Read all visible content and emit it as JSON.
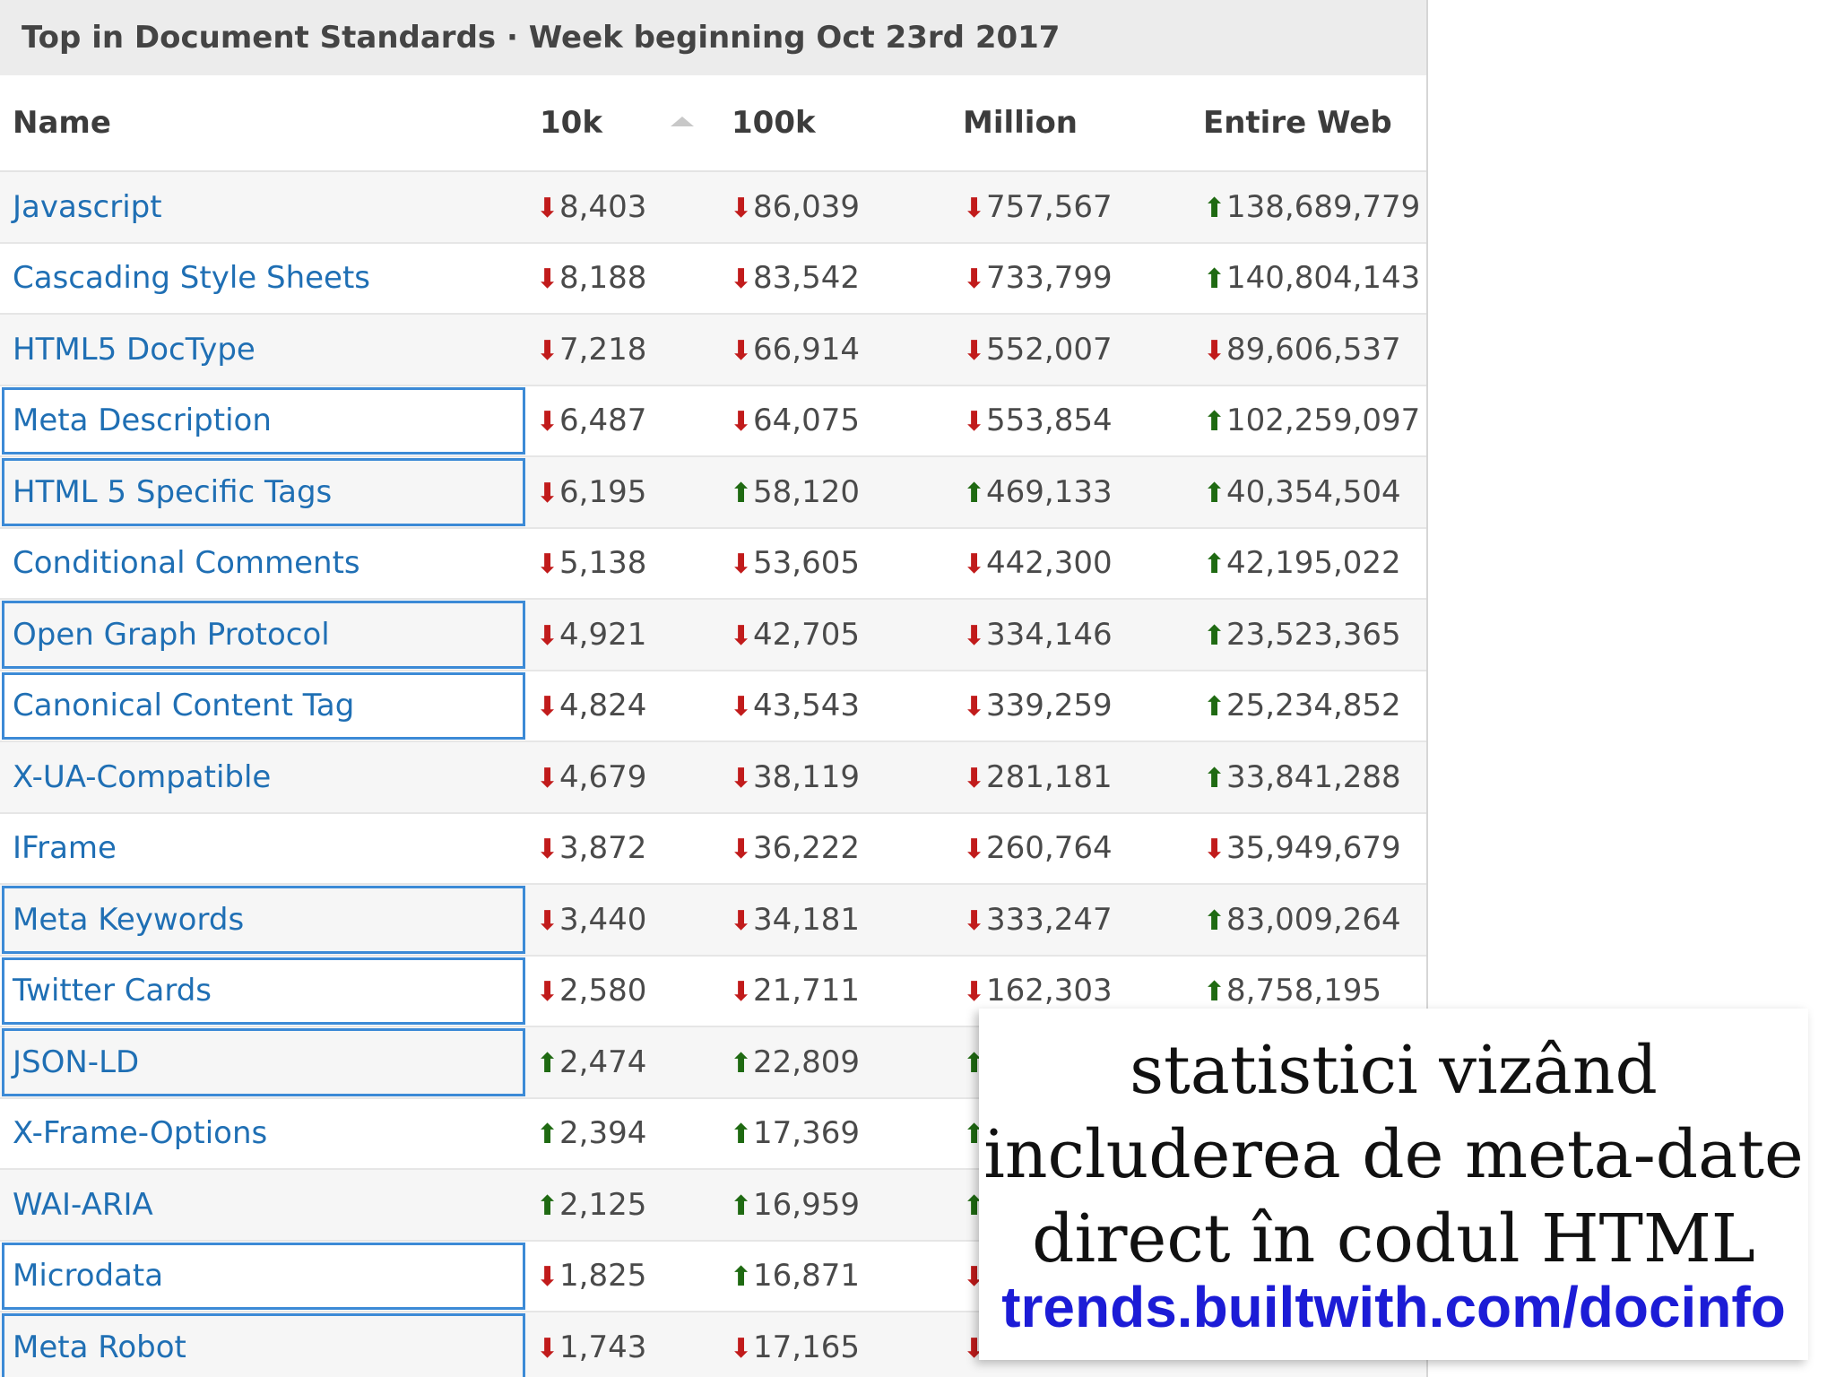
{
  "title": "Top in Document Standards · Week beginning Oct 23rd 2017",
  "columns": [
    "Name",
    "10k",
    "100k",
    "Million",
    "Entire Web"
  ],
  "sort_indicator": "sort-ascending-icon",
  "colors": {
    "link": "#1f6fb4",
    "down": "#c11b1b",
    "up": "#1f6a12",
    "selection_box": "#3c8ad6"
  },
  "rows": [
    {
      "name": "Javascript",
      "boxed": false,
      "k10": {
        "dir": "down",
        "value": "8,403"
      },
      "k100": {
        "dir": "down",
        "value": "86,039"
      },
      "million": {
        "dir": "down",
        "value": "757,567"
      },
      "web": {
        "dir": "up",
        "value": "138,689,779"
      }
    },
    {
      "name": "Cascading Style Sheets",
      "boxed": false,
      "k10": {
        "dir": "down",
        "value": "8,188"
      },
      "k100": {
        "dir": "down",
        "value": "83,542"
      },
      "million": {
        "dir": "down",
        "value": "733,799"
      },
      "web": {
        "dir": "up",
        "value": "140,804,143"
      }
    },
    {
      "name": "HTML5 DocType",
      "boxed": false,
      "k10": {
        "dir": "down",
        "value": "7,218"
      },
      "k100": {
        "dir": "down",
        "value": "66,914"
      },
      "million": {
        "dir": "down",
        "value": "552,007"
      },
      "web": {
        "dir": "down",
        "value": "89,606,537"
      }
    },
    {
      "name": "Meta Description",
      "boxed": true,
      "k10": {
        "dir": "down",
        "value": "6,487"
      },
      "k100": {
        "dir": "down",
        "value": "64,075"
      },
      "million": {
        "dir": "down",
        "value": "553,854"
      },
      "web": {
        "dir": "up",
        "value": "102,259,097"
      }
    },
    {
      "name": "HTML 5 Specific Tags",
      "boxed": true,
      "k10": {
        "dir": "down",
        "value": "6,195"
      },
      "k100": {
        "dir": "up",
        "value": "58,120"
      },
      "million": {
        "dir": "up",
        "value": "469,133"
      },
      "web": {
        "dir": "up",
        "value": "40,354,504"
      }
    },
    {
      "name": "Conditional Comments",
      "boxed": false,
      "k10": {
        "dir": "down",
        "value": "5,138"
      },
      "k100": {
        "dir": "down",
        "value": "53,605"
      },
      "million": {
        "dir": "down",
        "value": "442,300"
      },
      "web": {
        "dir": "up",
        "value": "42,195,022"
      }
    },
    {
      "name": "Open Graph Protocol",
      "boxed": true,
      "k10": {
        "dir": "down",
        "value": "4,921"
      },
      "k100": {
        "dir": "down",
        "value": "42,705"
      },
      "million": {
        "dir": "down",
        "value": "334,146"
      },
      "web": {
        "dir": "up",
        "value": "23,523,365"
      }
    },
    {
      "name": "Canonical Content Tag",
      "boxed": true,
      "k10": {
        "dir": "down",
        "value": "4,824"
      },
      "k100": {
        "dir": "down",
        "value": "43,543"
      },
      "million": {
        "dir": "down",
        "value": "339,259"
      },
      "web": {
        "dir": "up",
        "value": "25,234,852"
      }
    },
    {
      "name": "X-UA-Compatible",
      "boxed": false,
      "k10": {
        "dir": "down",
        "value": "4,679"
      },
      "k100": {
        "dir": "down",
        "value": "38,119"
      },
      "million": {
        "dir": "down",
        "value": "281,181"
      },
      "web": {
        "dir": "up",
        "value": "33,841,288"
      }
    },
    {
      "name": "IFrame",
      "boxed": false,
      "k10": {
        "dir": "down",
        "value": "3,872"
      },
      "k100": {
        "dir": "down",
        "value": "36,222"
      },
      "million": {
        "dir": "down",
        "value": "260,764"
      },
      "web": {
        "dir": "down",
        "value": "35,949,679"
      }
    },
    {
      "name": "Meta Keywords",
      "boxed": true,
      "k10": {
        "dir": "down",
        "value": "3,440"
      },
      "k100": {
        "dir": "down",
        "value": "34,181"
      },
      "million": {
        "dir": "down",
        "value": "333,247"
      },
      "web": {
        "dir": "up",
        "value": "83,009,264"
      }
    },
    {
      "name": "Twitter Cards",
      "boxed": true,
      "k10": {
        "dir": "down",
        "value": "2,580"
      },
      "k100": {
        "dir": "down",
        "value": "21,711"
      },
      "million": {
        "dir": "down",
        "value": "162,303"
      },
      "web": {
        "dir": "up",
        "value": "8,758,195"
      }
    },
    {
      "name": "JSON-LD",
      "boxed": true,
      "k10": {
        "dir": "up",
        "value": "2,474"
      },
      "k100": {
        "dir": "up",
        "value": "22,809"
      },
      "million": {
        "dir": "up",
        "value": ""
      },
      "web": {
        "dir": "",
        "value": ""
      }
    },
    {
      "name": "X-Frame-Options",
      "boxed": false,
      "k10": {
        "dir": "up",
        "value": "2,394"
      },
      "k100": {
        "dir": "up",
        "value": "17,369"
      },
      "million": {
        "dir": "up",
        "value": ""
      },
      "web": {
        "dir": "",
        "value": ""
      }
    },
    {
      "name": "WAI-ARIA",
      "boxed": false,
      "k10": {
        "dir": "up",
        "value": "2,125"
      },
      "k100": {
        "dir": "up",
        "value": "16,959"
      },
      "million": {
        "dir": "up",
        "value": ""
      },
      "web": {
        "dir": "",
        "value": ""
      }
    },
    {
      "name": "Microdata",
      "boxed": true,
      "k10": {
        "dir": "down",
        "value": "1,825"
      },
      "k100": {
        "dir": "up",
        "value": "16,871"
      },
      "million": {
        "dir": "down",
        "value": ""
      },
      "web": {
        "dir": "",
        "value": ""
      }
    },
    {
      "name": "Meta Robot",
      "boxed": true,
      "k10": {
        "dir": "down",
        "value": "1,743"
      },
      "k100": {
        "dir": "down",
        "value": "17,165"
      },
      "million": {
        "dir": "down",
        "value": ""
      },
      "web": {
        "dir": "",
        "value": ""
      }
    }
  ],
  "caption": {
    "lines": [
      "statistici vizând",
      "includerea de meta-date",
      "direct în codul HTML"
    ],
    "link": "trends.builtwith.com/docinfo"
  }
}
